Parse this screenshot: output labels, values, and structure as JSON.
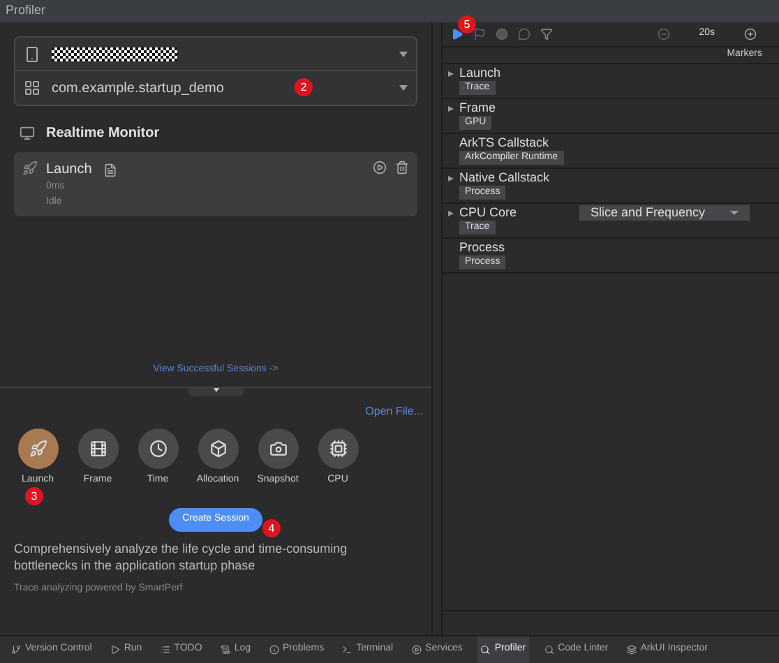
{
  "window": {
    "title": "Profiler"
  },
  "device_select": {
    "redacted": true
  },
  "app_select": {
    "value": "com.example.startup_demo",
    "annotation": "2"
  },
  "realtime_monitor": {
    "title": "Realtime Monitor",
    "session": {
      "name": "Launch",
      "duration": "0ms",
      "status": "Idle"
    }
  },
  "view_sessions_link": "View Successful Sessions ->",
  "open_file_link": "Open File...",
  "session_types": [
    {
      "label": "Launch",
      "selected": true,
      "annotation": "3"
    },
    {
      "label": "Frame",
      "selected": false
    },
    {
      "label": "Time",
      "selected": false
    },
    {
      "label": "Allocation",
      "selected": false
    },
    {
      "label": "Snapshot",
      "selected": false
    },
    {
      "label": "CPU",
      "selected": false
    }
  ],
  "create_button": {
    "label": "Create Session",
    "annotation": "4"
  },
  "description": "Comprehensively analyze the life cycle and time-consuming bottlenecks in the application startup phase",
  "powered_by": "Trace analyzing powered by SmartPerf",
  "toolbar": {
    "annotation": "5",
    "zoom": "20s",
    "markers": "Markers"
  },
  "lanes": [
    {
      "name": "Launch",
      "tag": "Trace",
      "expandable": true
    },
    {
      "name": "Frame",
      "tag": "GPU",
      "expandable": true
    },
    {
      "name": "ArkTS Callstack",
      "tag": "ArkCompiler Runtime",
      "expandable": false
    },
    {
      "name": "Native Callstack",
      "tag": "Process",
      "expandable": true
    },
    {
      "name": "CPU Core",
      "tag": "Trace",
      "expandable": true,
      "dropdown": "Slice and Frequency"
    },
    {
      "name": "Process",
      "tag": "Process",
      "expandable": false
    }
  ],
  "bottom_tabs": [
    {
      "label": "Version Control",
      "selected": false
    },
    {
      "label": "Run",
      "selected": false
    },
    {
      "label": "TODO",
      "selected": false
    },
    {
      "label": "Log",
      "selected": false
    },
    {
      "label": "Problems",
      "selected": false
    },
    {
      "label": "Terminal",
      "selected": false
    },
    {
      "label": "Services",
      "selected": false
    },
    {
      "label": "Profiler",
      "selected": true
    },
    {
      "label": "Code Linter",
      "selected": false
    },
    {
      "label": "ArkUI Inspector",
      "selected": false
    }
  ]
}
